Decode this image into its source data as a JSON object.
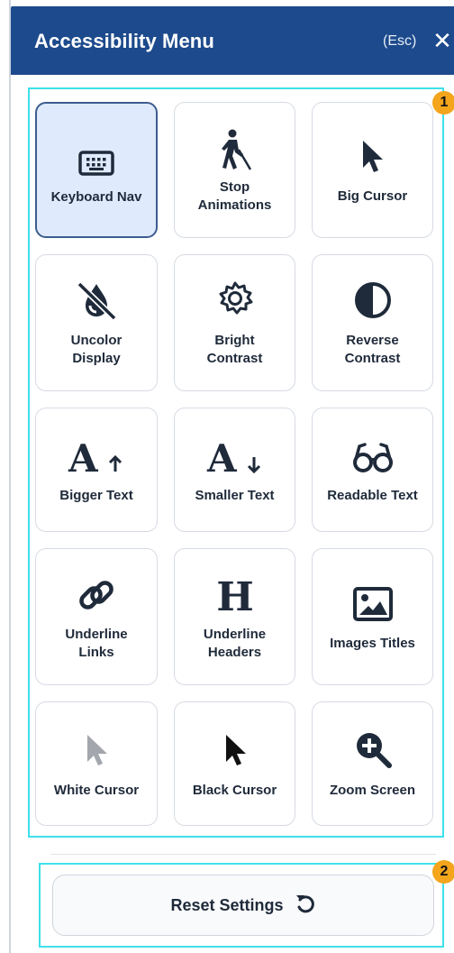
{
  "header": {
    "title": "Accessibility Menu",
    "esc_hint": "(Esc)",
    "close_glyph": "✕"
  },
  "callouts": [
    "1",
    "2"
  ],
  "tiles": [
    {
      "label": "Keyboard Nav",
      "icon": "keyboard-icon",
      "active": true
    },
    {
      "label": "Stop\nAnimations",
      "icon": "blind-person-icon",
      "active": false
    },
    {
      "label": "Big Cursor",
      "icon": "cursor-icon",
      "active": false
    },
    {
      "label": "Uncolor\nDisplay",
      "icon": "no-color-drop-icon",
      "active": false
    },
    {
      "label": "Bright\nContrast",
      "icon": "gear-sun-icon",
      "active": false
    },
    {
      "label": "Reverse\nContrast",
      "icon": "half-circle-icon",
      "active": false
    },
    {
      "label": "Bigger Text",
      "icon": "text-bigger-icon",
      "active": false
    },
    {
      "label": "Smaller Text",
      "icon": "text-smaller-icon",
      "active": false
    },
    {
      "label": "Readable Text",
      "icon": "glasses-icon",
      "active": false
    },
    {
      "label": "Underline\nLinks",
      "icon": "link-icon",
      "active": false
    },
    {
      "label": "Underline\nHeaders",
      "icon": "heading-icon",
      "active": false
    },
    {
      "label": "Images Titles",
      "icon": "image-icon",
      "active": false
    },
    {
      "label": "White Cursor",
      "icon": "white-cursor-icon",
      "active": false
    },
    {
      "label": "Black Cursor",
      "icon": "black-cursor-icon",
      "active": false
    },
    {
      "label": "Zoom Screen",
      "icon": "zoom-in-icon",
      "active": false
    }
  ],
  "reset": {
    "label": "Reset Settings",
    "icon": "reset-icon"
  },
  "colors": {
    "header_bg": "#1d4a8c",
    "icon_dark": "#1f2a3a",
    "active_bg": "#dfeafc",
    "highlight": "#3ee0ea",
    "badge": "#f4a51c"
  }
}
